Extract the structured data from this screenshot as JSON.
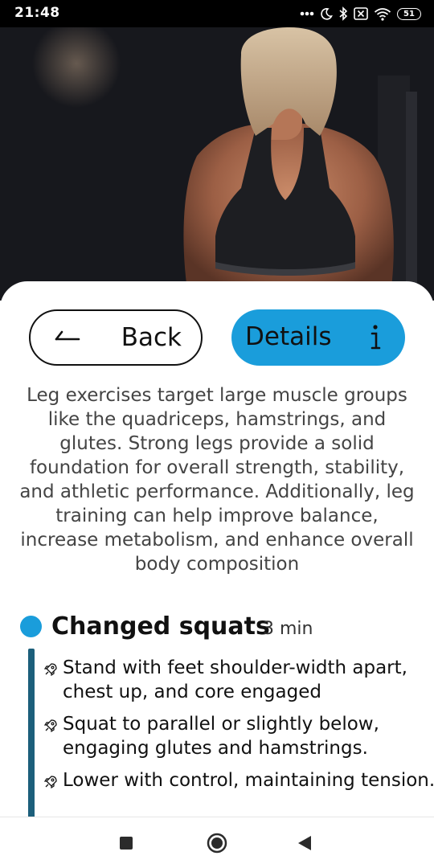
{
  "status_bar": {
    "time": "21:48",
    "battery": "51",
    "icons": [
      "more-dots-icon",
      "moon-icon",
      "bluetooth-icon",
      "sim-disabled-icon",
      "wifi-icon",
      "battery-icon"
    ]
  },
  "hero": {
    "image": "woman-back-gym-photo"
  },
  "buttons": {
    "back_label": "Back",
    "details_label": "Details",
    "back_icon": "arrow-left-icon",
    "details_icon": "info-icon"
  },
  "description": "Leg exercises target large muscle groups like the quadriceps, hamstrings, and glutes. Strong legs provide a solid foundation for overall strength, stability, and athletic performance. Additionally, leg training can help improve balance, increase metabolism, and enhance overall body composition",
  "exercise": {
    "title": "Changed squats",
    "duration": "3 min",
    "steps": [
      {
        "line1": "Stand with feet shoulder-width apart,",
        "line2": "chest up, and core engaged"
      },
      {
        "line1": "Squat to parallel or slightly below,",
        "line2": "engaging glutes and hamstrings."
      },
      {
        "line1": "Lower with control, maintaining tension.",
        "line2": ""
      }
    ]
  },
  "nav_bar": {
    "icons": [
      "recent-apps-icon",
      "home-icon",
      "back-triangle-icon"
    ]
  },
  "colors": {
    "accent": "#1a9ddb",
    "timeline": "#1c5f7b",
    "text": "#111111",
    "description_text": "#444444"
  }
}
